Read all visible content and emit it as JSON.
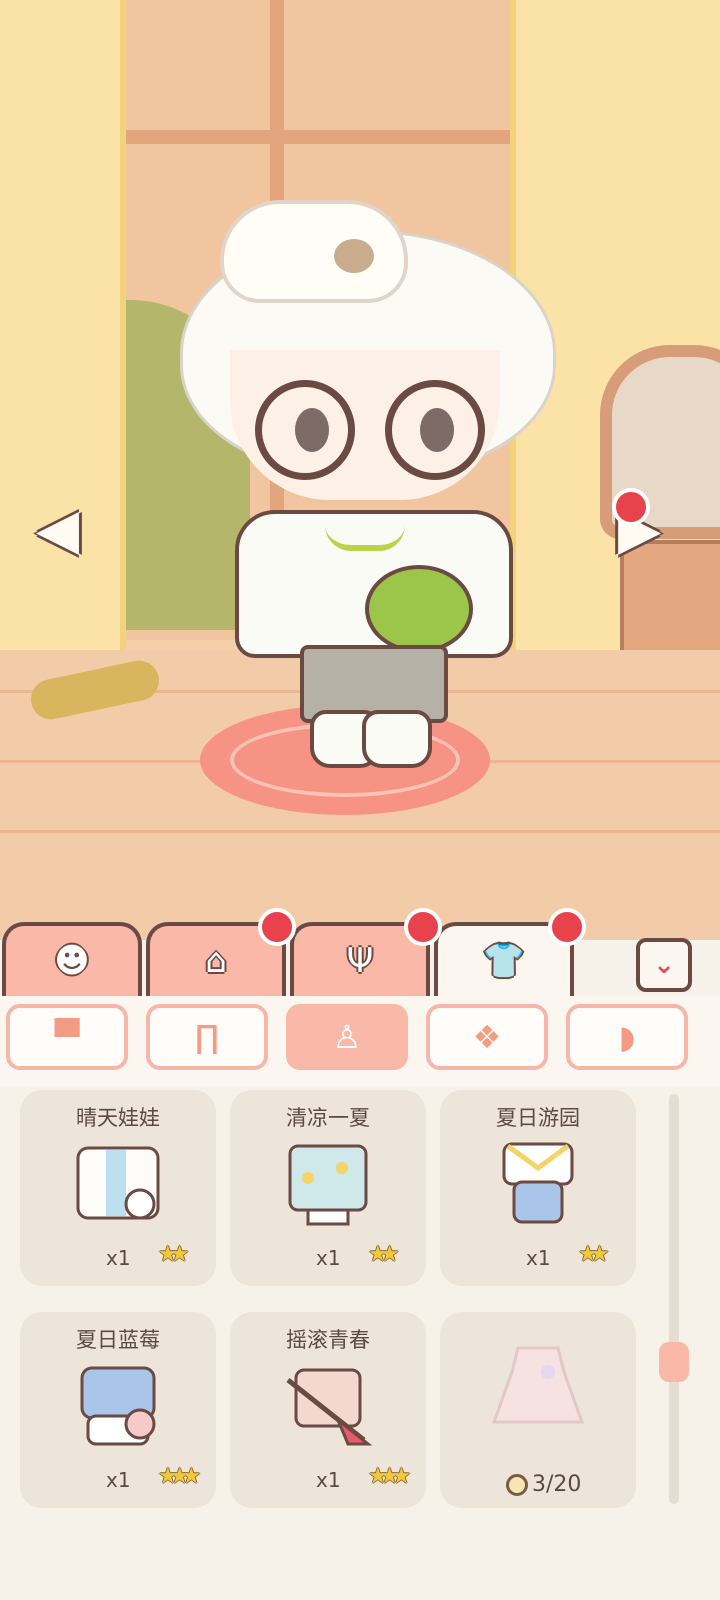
{
  "scene": {
    "nav_prev_icon": "chevron-left-icon",
    "nav_next_icon": "chevron-right-icon"
  },
  "main_tabs": [
    {
      "icon": "face-icon",
      "glyph": "☻",
      "badge": false
    },
    {
      "icon": "house-icon",
      "glyph": "⌂",
      "badge": true
    },
    {
      "icon": "food-icon",
      "glyph": "Ψ",
      "badge": true
    },
    {
      "icon": "shirt-icon",
      "glyph": "👕",
      "badge": true,
      "active": true
    }
  ],
  "collapse_glyph": "⌄",
  "categories": [
    {
      "icon": "top-icon",
      "glyph": "▀"
    },
    {
      "icon": "pants-icon",
      "glyph": "∏"
    },
    {
      "icon": "dress-icon",
      "glyph": "♙",
      "active": true
    },
    {
      "icon": "socks-icon",
      "glyph": "❖"
    },
    {
      "icon": "hair-icon",
      "glyph": "◗"
    }
  ],
  "outfits": [
    {
      "name": "晴天娃娃",
      "count": "x1",
      "stars": "★★"
    },
    {
      "name": "清凉一夏",
      "count": "x1",
      "stars": "★★"
    },
    {
      "name": "夏日游园",
      "count": "x1",
      "stars": "★★"
    },
    {
      "name": "夏日蓝莓",
      "count": "x1",
      "stars": "★★★"
    },
    {
      "name": "摇滚青春",
      "count": "x1",
      "stars": "★★★"
    },
    {
      "name": "",
      "progress": "3/20"
    }
  ],
  "colors": {
    "accent": "#f9b8a8",
    "badge": "#e8434d",
    "outline": "#6a4a43",
    "star": "#f2c83c"
  }
}
